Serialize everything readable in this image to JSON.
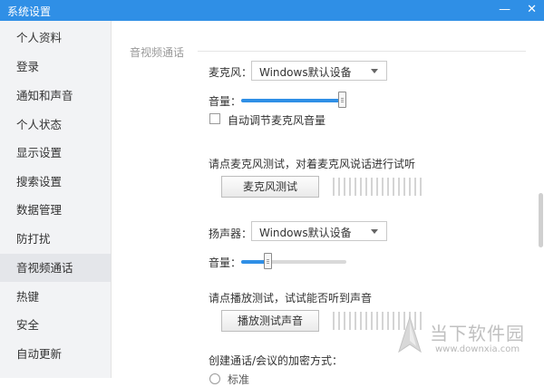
{
  "window": {
    "title": "系统设置",
    "minimize_glyph": "—",
    "close_glyph": "✕"
  },
  "sidebar": {
    "items": [
      {
        "label": "个人资料"
      },
      {
        "label": "登录"
      },
      {
        "label": "通知和声音"
      },
      {
        "label": "个人状态"
      },
      {
        "label": "显示设置"
      },
      {
        "label": "搜索设置"
      },
      {
        "label": "数据管理"
      },
      {
        "label": "防打扰"
      },
      {
        "label": "音视频通话"
      },
      {
        "label": "热键"
      },
      {
        "label": "安全"
      },
      {
        "label": "自动更新"
      }
    ],
    "active_label": "音视频通话"
  },
  "av": {
    "section_title": "音视频通话",
    "mic": {
      "label": "麦克风：",
      "device": "Windows默认设备",
      "volume_label": "音量：",
      "volume_percent": 100,
      "auto_adjust_label": "自动调节麦克风音量",
      "auto_adjust_checked": false,
      "test_hint": "请点麦克风测试，对着麦克风说话进行试听",
      "test_button": "麦克风测试"
    },
    "speaker": {
      "label": "扬声器：",
      "device": "Windows默认设备",
      "volume_label": "音量：",
      "volume_percent": 25,
      "test_hint": "请点播放测试，试试能否听到声音",
      "test_button": "播放测试声音"
    },
    "encryption": {
      "label": "创建通话/会议的加密方式：",
      "option_partial": "标准"
    }
  },
  "watermark": {
    "cn": "当下软件园",
    "url": "www.downxia.com"
  },
  "colors": {
    "titlebar": "#2f8fe6",
    "accent": "#2f8fe6"
  }
}
